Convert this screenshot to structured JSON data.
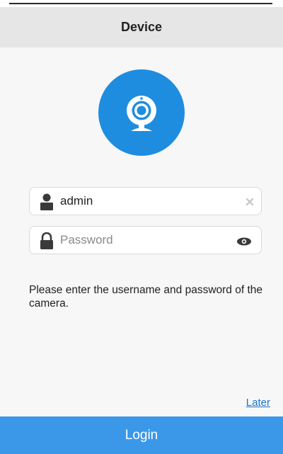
{
  "header": {
    "title": "Device"
  },
  "form": {
    "username_value": "admin",
    "password_placeholder": "Password"
  },
  "hint_text": "Please enter the username and password of the camera.",
  "later_label": "Later",
  "login_label": "Login",
  "colors": {
    "accent": "#1e8ddf",
    "login_button": "#3b98e8",
    "link": "#1a73c9",
    "header_bg": "#e6e6e6"
  },
  "icons": {
    "avatar": "webcam-icon",
    "username": "user-icon",
    "password": "lock-icon",
    "clear": "clear-icon",
    "visibility": "eye-icon"
  }
}
